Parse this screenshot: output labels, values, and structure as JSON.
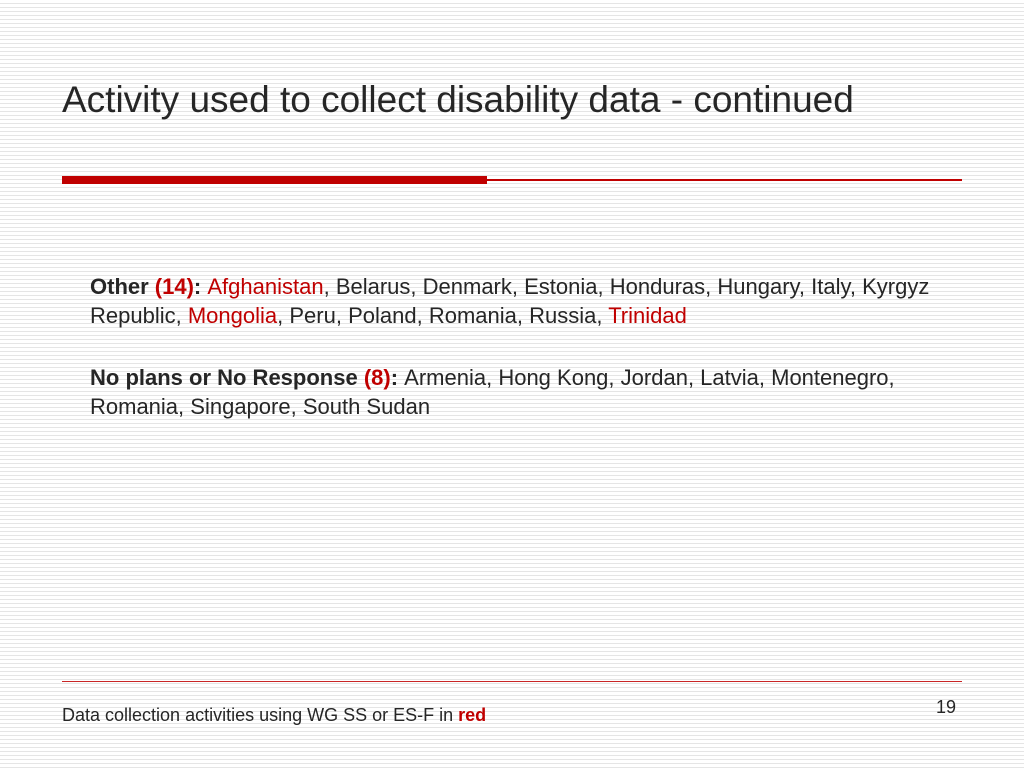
{
  "title": "Activity used to collect disability data - continued",
  "sections": [
    {
      "label": "Other",
      "count_display": "(14)",
      "items": [
        {
          "text": "Afghanistan",
          "red": true
        },
        {
          "text": "Belarus",
          "red": false
        },
        {
          "text": "Denmark",
          "red": false
        },
        {
          "text": "Estonia",
          "red": false
        },
        {
          "text": "Honduras",
          "red": false
        },
        {
          "text": "Hungary",
          "red": false
        },
        {
          "text": "Italy",
          "red": false
        },
        {
          "text": "Kyrgyz Republic",
          "red": false
        },
        {
          "text": "Mongolia",
          "red": true
        },
        {
          "text": "Peru",
          "red": false
        },
        {
          "text": "Poland",
          "red": false
        },
        {
          "text": "Romania",
          "red": false
        },
        {
          "text": "Russia",
          "red": false
        },
        {
          "text": "Trinidad",
          "red": true
        }
      ]
    },
    {
      "label": "No plans or No Response",
      "count_display": "(8)",
      "items": [
        {
          "text": "Armenia",
          "red": false
        },
        {
          "text": "Hong Kong",
          "red": false
        },
        {
          "text": "Jordan",
          "red": false
        },
        {
          "text": "Latvia",
          "red": false
        },
        {
          "text": "Montenegro",
          "red": false
        },
        {
          "text": "Romania",
          "red": false
        },
        {
          "text": "Singapore",
          "red": false
        },
        {
          "text": "South Sudan",
          "red": false
        }
      ]
    }
  ],
  "footer_note_prefix": "Data collection activities using WG SS or ES-F in ",
  "footer_note_red_word": "red",
  "page_number": "19",
  "colors": {
    "accent": "#c00000",
    "text": "#262626"
  }
}
